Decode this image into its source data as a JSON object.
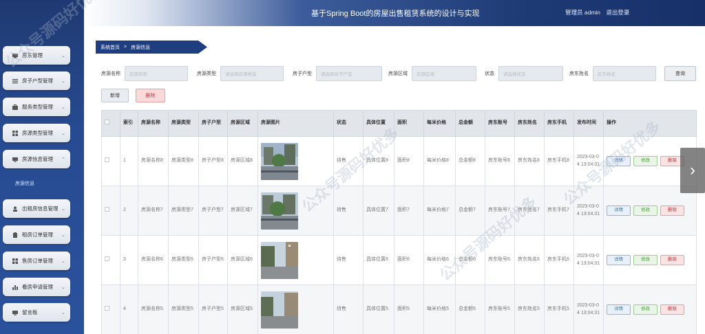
{
  "header": {
    "app_title": "基于Spring Boot的房屋出售租赁系统的设计与实现",
    "user_label": "管理员 admin",
    "logout_label": "退出登录"
  },
  "sidebar": {
    "items": [
      {
        "label": "房东管理",
        "icon": "user-icon",
        "expanded": false
      },
      {
        "label": "房子户型管理",
        "icon": "list-icon",
        "expanded": false
      },
      {
        "label": "服务类型管理",
        "icon": "briefcase-icon",
        "expanded": false
      },
      {
        "label": "房源类型管理",
        "icon": "grid-icon",
        "expanded": false
      },
      {
        "label": "房源信息管理",
        "icon": "monitor-icon",
        "expanded": true
      },
      {
        "label": "出租房信息管理",
        "icon": "user-icon",
        "expanded": false
      },
      {
        "label": "租房订单管理",
        "icon": "clipboard-icon",
        "expanded": false
      },
      {
        "label": "售房订单管理",
        "icon": "grid-icon",
        "expanded": false
      },
      {
        "label": "看房申请管理",
        "icon": "bar-chart-icon",
        "expanded": false
      },
      {
        "label": "留言板",
        "icon": "monitor-icon",
        "expanded": false
      }
    ],
    "submenu_item": "房源信息"
  },
  "breadcrumb": {
    "home": "系统首页",
    "separator": ">",
    "current": "房源信息"
  },
  "filters": [
    {
      "label": "房源名称",
      "placeholder": "房源名称"
    },
    {
      "label": "房源类型",
      "placeholder": "请选择房源类型"
    },
    {
      "label": "房子户型",
      "placeholder": "请选择房子户型"
    },
    {
      "label": "房源区域",
      "placeholder": "房源区域"
    },
    {
      "label": "状态",
      "placeholder": "请选择状态"
    },
    {
      "label": "房东姓名",
      "placeholder": "房东姓名"
    }
  ],
  "buttons": {
    "search": "查询",
    "add": "新增",
    "batch_delete": "删除"
  },
  "table": {
    "headers": [
      "索引",
      "房源名称",
      "房源类型",
      "房子户型",
      "房源区域",
      "房源图片",
      "状态",
      "具体位置",
      "面积",
      "每米价格",
      "总金额",
      "房东账号",
      "房东姓名",
      "房东手机",
      "发布时间",
      "操作"
    ],
    "rows": [
      {
        "index": "1",
        "name": "房源名称8",
        "type": "房源类型8",
        "layout": "房子户型8",
        "region": "房源区域8",
        "status": "待售",
        "location": "具体位置8",
        "area": "面积8",
        "price": "每米价格8",
        "total": "总金额8",
        "account": "房东账号8",
        "owner": "房东姓名8",
        "phone": "房东手机8",
        "time": "2023-03-04 13:04:31"
      },
      {
        "index": "2",
        "name": "房源名称7",
        "type": "房源类型7",
        "layout": "房子户型7",
        "region": "房源区域7",
        "status": "待售",
        "location": "具体位置7",
        "area": "面积7",
        "price": "每米价格7",
        "total": "总金额7",
        "account": "房东账号7",
        "owner": "房东姓名7",
        "phone": "房东手机7",
        "time": "2023-03-04 13:04:31"
      },
      {
        "index": "3",
        "name": "房源名称6",
        "type": "房源类型6",
        "layout": "房子户型6",
        "region": "房源区域6",
        "status": "待售",
        "location": "具体位置6",
        "area": "面积6",
        "price": "每米价格6",
        "total": "总金额6",
        "account": "房东账号6",
        "owner": "房东姓名6",
        "phone": "房东手机6",
        "time": "2023-03-04 13:04:31"
      },
      {
        "index": "4",
        "name": "房源名称5",
        "type": "房源类型5",
        "layout": "房子户型5",
        "region": "房源区域5",
        "status": "待售",
        "location": "具体位置5",
        "area": "面积5",
        "price": "每米价格5",
        "total": "总金额5",
        "account": "房东账号5",
        "owner": "房东姓名5",
        "phone": "房东手机5",
        "time": "2023-03-04 13:04:31"
      }
    ],
    "row_actions": {
      "detail": "详情",
      "edit": "修改",
      "delete": "删除"
    }
  },
  "watermark_text": "公众号源码好优多",
  "colors": {
    "sidebar": "#274b91",
    "header_dark": "#1e3b75",
    "delete": "#c6373e",
    "edit": "#4e9a41",
    "detail": "#3a77c0"
  }
}
